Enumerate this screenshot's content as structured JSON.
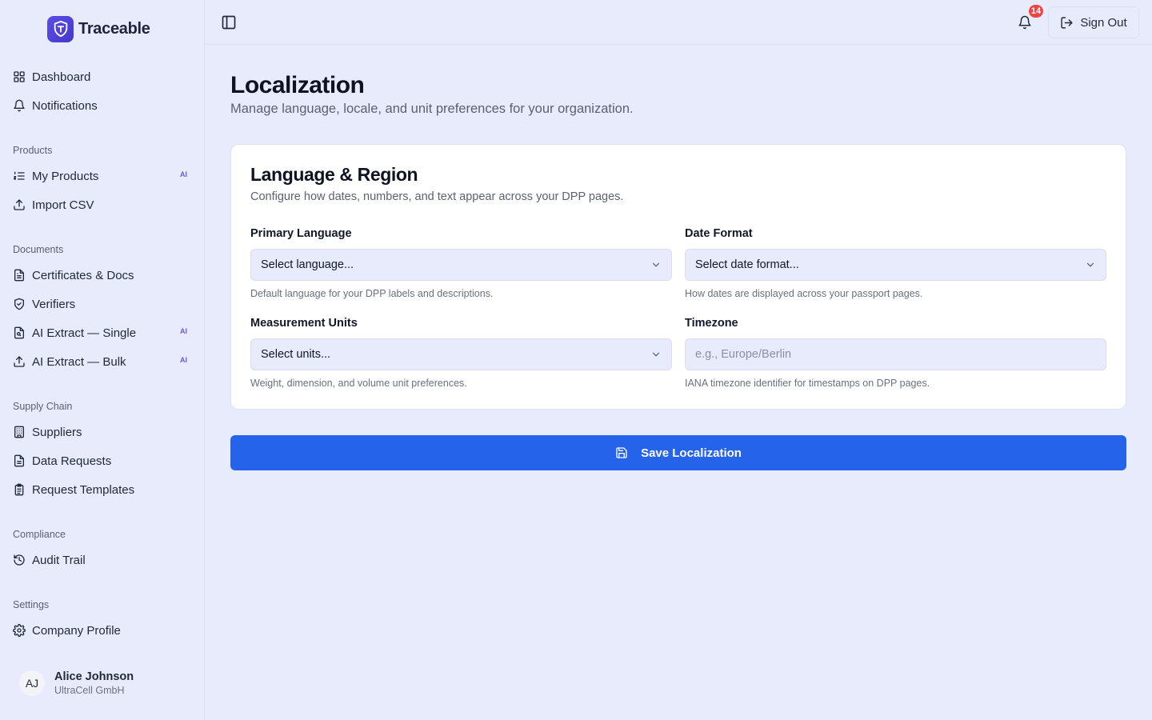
{
  "brand": {
    "name": "Traceable"
  },
  "sidebar": {
    "top_items": [
      {
        "label": "Dashboard",
        "icon": "grid-icon"
      },
      {
        "label": "Notifications",
        "icon": "bell-icon"
      }
    ],
    "sections": [
      {
        "title": "Products",
        "items": [
          {
            "label": "My Products",
            "badge": "AI"
          },
          {
            "label": "Import CSV"
          }
        ]
      },
      {
        "title": "Documents",
        "items": [
          {
            "label": "Certificates & Docs"
          },
          {
            "label": "Verifiers"
          },
          {
            "label": "AI Extract — Single",
            "badge": "AI"
          },
          {
            "label": "AI Extract — Bulk",
            "badge": "AI"
          }
        ]
      },
      {
        "title": "Supply Chain",
        "items": [
          {
            "label": "Suppliers"
          },
          {
            "label": "Data Requests"
          },
          {
            "label": "Request Templates"
          }
        ]
      },
      {
        "title": "Compliance",
        "items": [
          {
            "label": "Audit Trail"
          }
        ]
      },
      {
        "title": "Settings",
        "items": [
          {
            "label": "Company Profile"
          }
        ]
      }
    ],
    "user": {
      "initials": "AJ",
      "name": "Alice Johnson",
      "company": "UltraCell GmbH"
    }
  },
  "topbar": {
    "notification_count": "14",
    "sign_out_label": "Sign Out"
  },
  "page": {
    "title": "Localization",
    "subtitle": "Manage language, locale, and unit preferences for your organization."
  },
  "card": {
    "title": "Language & Region",
    "description": "Configure how dates, numbers, and text appear across your DPP pages.",
    "fields": {
      "language": {
        "label": "Primary Language",
        "value": "Select language...",
        "help": "Default language for your DPP labels and descriptions."
      },
      "date_format": {
        "label": "Date Format",
        "value": "Select date format...",
        "help": "How dates are displayed across your passport pages."
      },
      "units": {
        "label": "Measurement Units",
        "value": "Select units...",
        "help": "Weight, dimension, and volume unit preferences."
      },
      "timezone": {
        "label": "Timezone",
        "placeholder": "e.g., Europe/Berlin",
        "value": "",
        "help": "IANA timezone identifier for timestamps on DPP pages."
      }
    }
  },
  "save_button": {
    "label": "Save Localization"
  },
  "colors": {
    "accent": "#2563eb",
    "background": "#e8ebfb",
    "badge": "#ef4444",
    "brand": "#4f46e5"
  }
}
